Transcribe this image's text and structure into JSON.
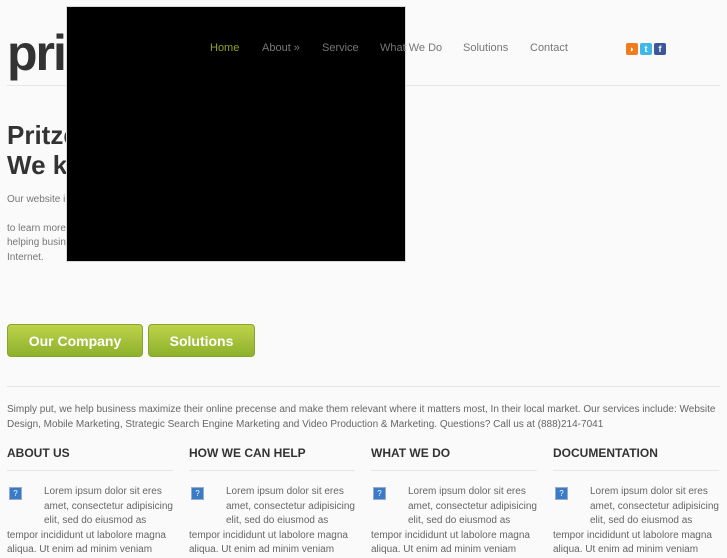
{
  "logo": "pri",
  "nav": [
    {
      "label": "Home"
    },
    {
      "label": "About »"
    },
    {
      "label": "Service"
    },
    {
      "label": "What We Do"
    },
    {
      "label": "Solutions"
    },
    {
      "label": "Contact"
    }
  ],
  "hero": {
    "title_line1": "Pritze",
    "title_line2": "We k",
    "p1": "Our website i",
    "p2": "to learn more",
    "p3": "helping busin",
    "p4": "Internet."
  },
  "buttons": {
    "company": "Our Company",
    "solutions": "Solutions"
  },
  "intro": "Simply put, we help business maximize their online precense and make them relevant where it matters most, In their local market. Our services include: Website Design, Mobile Marketing, Strategic Search Engine Marketing and Video Production & Marketing. Questions? Call us at (888)214-7041",
  "columns": [
    {
      "title": "ABOUT US",
      "text": "Lorem ipsum dolor sit eres amet, consectetur adipisicing elit, sed do eiusmod as tempor incididunt ut labolore magna aliqua. Ut enim ad minim veniam"
    },
    {
      "title": "HOW WE CAN HELP",
      "text": "Lorem ipsum dolor sit eres amet, consectetur adipisicing elit, sed do eiusmod as tempor incididunt ut labolore magna aliqua. Ut enim ad minim veniam"
    },
    {
      "title": "WHAT WE DO",
      "text": "Lorem ipsum dolor sit eres amet, consectetur adipisicing elit, sed do eiusmod as tempor incididunt ut labolore magna aliqua. Ut enim ad minim veniam"
    },
    {
      "title": "DOCUMENTATION",
      "text": "Lorem ipsum dolor sit eres amet, consectetur adipisicing elit, sed do eiusmod as tempor incididunt ut labolore magna aliqua. Ut enim ad minim veniam"
    }
  ],
  "colors": {
    "accent": "#8ca51c",
    "rss": "#f07c1c",
    "twitter": "#3fb8e8",
    "facebook": "#3b5998"
  }
}
